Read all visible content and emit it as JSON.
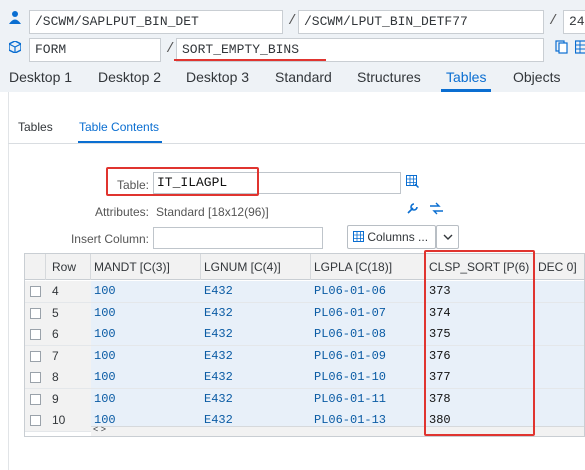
{
  "header": {
    "program": "/SCWM/SAPLPUT_BIN_DET",
    "include": "/SCWM/LPUT_BIN_DETF77",
    "line": "24",
    "type": "FORM",
    "name": "SORT_EMPTY_BINS"
  },
  "tabs": [
    "Desktop 1",
    "Desktop 2",
    "Desktop 3",
    "Standard",
    "Structures",
    "Tables",
    "Objects"
  ],
  "active_tab": "Tables",
  "subtabs": [
    "Tables",
    "Table Contents"
  ],
  "active_subtab": "Table Contents",
  "form": {
    "table_label": "Table:",
    "table_value": "IT_ILAGPL",
    "attributes_label": "Attributes:",
    "attributes_value": "Standard [18x12(96)]",
    "insert_column_label": "Insert Column:",
    "insert_column_value": "",
    "columns_button": "Columns ..."
  },
  "grid": {
    "headers": [
      "Row",
      "MANDT [C(3)]",
      "LGNUM [C(4)]",
      "LGPLA [C(18)]",
      "CLSP_SORT [P(6)",
      "DEC 0]"
    ],
    "rows": [
      {
        "row": "4",
        "mandt": "100",
        "lgnum": "E432",
        "lgpla": "PL06-01-06",
        "sort": "373"
      },
      {
        "row": "5",
        "mandt": "100",
        "lgnum": "E432",
        "lgpla": "PL06-01-07",
        "sort": "374"
      },
      {
        "row": "6",
        "mandt": "100",
        "lgnum": "E432",
        "lgpla": "PL06-01-08",
        "sort": "375"
      },
      {
        "row": "7",
        "mandt": "100",
        "lgnum": "E432",
        "lgpla": "PL06-01-09",
        "sort": "376"
      },
      {
        "row": "8",
        "mandt": "100",
        "lgnum": "E432",
        "lgpla": "PL06-01-10",
        "sort": "377"
      },
      {
        "row": "9",
        "mandt": "100",
        "lgnum": "E432",
        "lgpla": "PL06-01-11",
        "sort": "378"
      },
      {
        "row": "10",
        "mandt": "100",
        "lgnum": "E432",
        "lgpla": "PL06-01-13",
        "sort": "380"
      }
    ],
    "scroll_arrows": "< >"
  },
  "colors": {
    "accent": "#0a6ed1",
    "highlight": "#e0342f",
    "toolbar_bg": "#eef2f6"
  },
  "icons": [
    "user-icon",
    "object-icon",
    "copy-icon",
    "table-icon",
    "wrench-icon",
    "convert-icon",
    "grid-icon",
    "dropdown-icon"
  ]
}
